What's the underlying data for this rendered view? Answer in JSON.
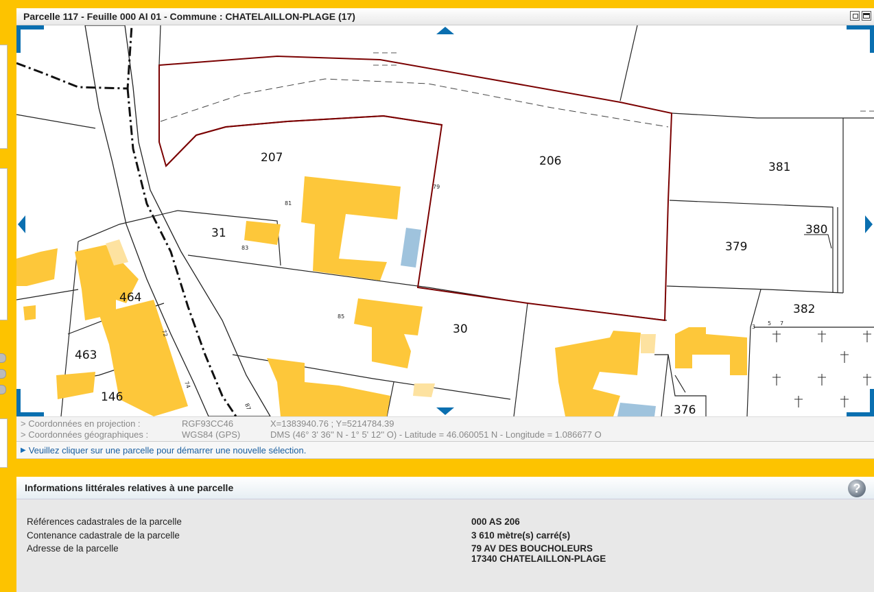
{
  "map": {
    "title": "Parcelle 117 - Feuille 000 AI 01 - Commune : CHATELAILLON-PLAGE (17)",
    "parcel_labels": [
      "207",
      "206",
      "381",
      "380",
      "379",
      "31",
      "464",
      "30",
      "382",
      "463",
      "146",
      "376"
    ],
    "small_labels": [
      "79",
      "81",
      "83",
      "85",
      "72",
      "74",
      "87",
      "5",
      "7",
      "3"
    ]
  },
  "coords": {
    "projection_label": "> Coordonnées en projection :",
    "projection_system": "RGF93CC46",
    "projection_value": "X=1383940.76 ; Y=5214784.39",
    "geo_label": "> Coordonnées géographiques :",
    "geo_system": "WGS84 (GPS)",
    "geo_value": "DMS (46° 3' 36'' N - 1° 5' 12'' O) - Latitude = 46.060051 N - Longitude = 1.086677 O"
  },
  "message": "Veuillez cliquer sur une parcelle pour démarrer une nouvelle sélection.",
  "info": {
    "title": "Informations littérales relatives à une parcelle",
    "help": "?",
    "rows": [
      {
        "label": "Références cadastrales de la parcelle",
        "value": "000 AS 206"
      },
      {
        "label": "Contenance cadastrale de la parcelle",
        "value": "3 610 mètre(s) carré(s)"
      },
      {
        "label": "Adresse de la parcelle",
        "value": "79 AV DES BOUCHOLEURS",
        "value2": "17340 CHATELAILLON-PLAGE"
      }
    ]
  },
  "colors": {
    "background": "#fdc300",
    "building": "#fdc73a",
    "building_light": "#fde2a0",
    "water": "#9fc3dd",
    "selection": "#7a0000",
    "nav": "#0a6fb0"
  }
}
